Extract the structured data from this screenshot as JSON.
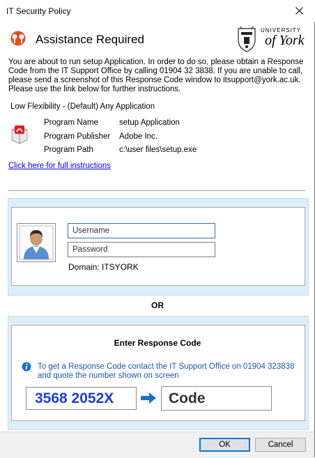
{
  "window": {
    "title": "IT Security Policy"
  },
  "header": {
    "title": "Assistance Required",
    "logo_line1": "UNIVERSITY",
    "logo_line2": "of York"
  },
  "intro": "You are about to run setup Application. In order to do so, please obtain a Response Code from the IT Support Office by calling 01904 32 3838. If you are unable to call, please send a screenshot of this Response Code window to itsupport@york.ac.uk. Please use the link below for further instructions.",
  "flexibility": "Low Flexibility - (Default) Any Application",
  "program": {
    "name_label": "Program Name",
    "name_value": "setup Application",
    "publisher_label": "Program Publisher",
    "publisher_value": "Adobe Inc.",
    "path_label": "Program Path",
    "path_value": "c:\\user files\\setup.exe"
  },
  "instructions_link": "Click here for full instructions",
  "login": {
    "username_placeholder": "Username",
    "password_placeholder": "Password",
    "domain": "Domain: ITSYORK"
  },
  "or_label": "OR",
  "response": {
    "title": "Enter Response Code",
    "info": "To get a Response Code contact the IT Support Office on 01904 323838 and quote the number shown on screen",
    "code": "3568 2052X",
    "code_placeholder": "Code"
  },
  "buttons": {
    "ok": "OK",
    "cancel": "Cancel"
  },
  "colors": {
    "accent": "#0078d7",
    "code_text": "#1f3fd0",
    "info_text": "#1a57b0",
    "panel_bg": "#ddeef8",
    "header_icon": "#e0501e"
  }
}
